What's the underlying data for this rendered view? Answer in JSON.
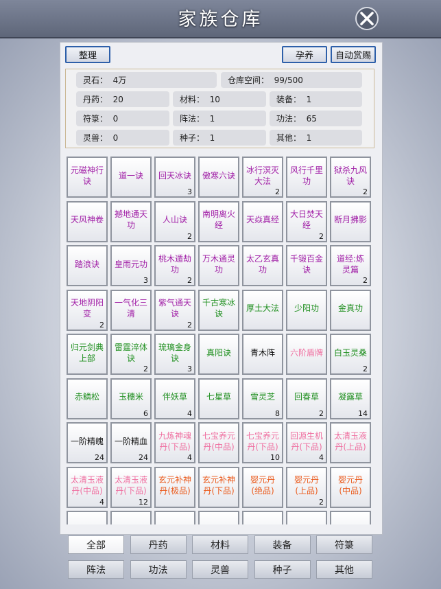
{
  "title": "家族仓库",
  "toolbar": {
    "sort": "整理",
    "breed": "孕养",
    "auto_reward": "自动赏赐"
  },
  "info": [
    {
      "label": "灵石：",
      "value": "4万"
    },
    {
      "label": "仓库空间：",
      "value": "99/500"
    },
    {
      "label": "丹药：",
      "value": "20"
    },
    {
      "label": "材料：",
      "value": "10"
    },
    {
      "label": "装备：",
      "value": "1"
    },
    {
      "label": "符箓：",
      "value": "0"
    },
    {
      "label": "阵法：",
      "value": "1"
    },
    {
      "label": "功法：",
      "value": "65"
    },
    {
      "label": "灵兽：",
      "value": "0"
    },
    {
      "label": "种子：",
      "value": "1"
    },
    {
      "label": "其他：",
      "value": "1"
    }
  ],
  "colors": {
    "purple": "#a01ea6",
    "green": "#1f8f1f",
    "black": "#111111",
    "pink": "#ef6fa0",
    "orange": "#ea5a1c"
  },
  "items": [
    {
      "name": "元磁神行诀",
      "count": "",
      "color": "purple"
    },
    {
      "name": "道一诀",
      "count": "",
      "color": "purple"
    },
    {
      "name": "回天冰诀",
      "count": "3",
      "color": "purple"
    },
    {
      "name": "傲寒六诀",
      "count": "",
      "color": "purple"
    },
    {
      "name": "冰行溟灭大法",
      "count": "2",
      "color": "purple"
    },
    {
      "name": "风行千里功",
      "count": "",
      "color": "purple"
    },
    {
      "name": "狱杀九风诀",
      "count": "2",
      "color": "purple"
    },
    {
      "name": "天风神卷",
      "count": "",
      "color": "purple"
    },
    {
      "name": "撼地通天功",
      "count": "",
      "color": "purple"
    },
    {
      "name": "人山诀",
      "count": "2",
      "color": "purple"
    },
    {
      "name": "南明离火经",
      "count": "",
      "color": "purple"
    },
    {
      "name": "天焱真经",
      "count": "",
      "color": "purple"
    },
    {
      "name": "大日焚天经",
      "count": "2",
      "color": "purple"
    },
    {
      "name": "断月拂影",
      "count": "",
      "color": "purple"
    },
    {
      "name": "踏浪诀",
      "count": "",
      "color": "purple"
    },
    {
      "name": "皇雨元功",
      "count": "3",
      "color": "purple"
    },
    {
      "name": "桃木遁劫功",
      "count": "2",
      "color": "purple"
    },
    {
      "name": "万木通灵功",
      "count": "",
      "color": "purple"
    },
    {
      "name": "太乙玄真功",
      "count": "",
      "color": "purple"
    },
    {
      "name": "千锻百金诀",
      "count": "",
      "color": "purple"
    },
    {
      "name": "道经:炼灵篇",
      "count": "2",
      "color": "purple"
    },
    {
      "name": "天地阴阳变",
      "count": "2",
      "color": "purple"
    },
    {
      "name": "一气化三清",
      "count": "",
      "color": "purple"
    },
    {
      "name": "紫气通天诀",
      "count": "2",
      "color": "purple"
    },
    {
      "name": "千古寒冰诀",
      "count": "",
      "color": "green"
    },
    {
      "name": "厚土大法",
      "count": "",
      "color": "green"
    },
    {
      "name": "少阳功",
      "count": "",
      "color": "green"
    },
    {
      "name": "金真功",
      "count": "",
      "color": "green"
    },
    {
      "name": "归元剑典上部",
      "count": "",
      "color": "green"
    },
    {
      "name": "雷霆淬体诀",
      "count": "2",
      "color": "green"
    },
    {
      "name": "琉璃金身诀",
      "count": "3",
      "color": "green"
    },
    {
      "name": "真阳诀",
      "count": "",
      "color": "green"
    },
    {
      "name": "青木阵",
      "count": "",
      "color": "black"
    },
    {
      "name": "六阶盾牌",
      "count": "",
      "color": "pink"
    },
    {
      "name": "白玉灵桑",
      "count": "2",
      "color": "green"
    },
    {
      "name": "赤鳞松",
      "count": "",
      "color": "green"
    },
    {
      "name": "玉穗米",
      "count": "6",
      "color": "green"
    },
    {
      "name": "伴妖草",
      "count": "4",
      "color": "green"
    },
    {
      "name": "七星草",
      "count": "",
      "color": "green"
    },
    {
      "name": "雪灵芝",
      "count": "8",
      "color": "green"
    },
    {
      "name": "回春草",
      "count": "2",
      "color": "green"
    },
    {
      "name": "凝露草",
      "count": "14",
      "color": "green"
    },
    {
      "name": "一阶精魄",
      "count": "24",
      "color": "black"
    },
    {
      "name": "一阶精血",
      "count": "24",
      "color": "black"
    },
    {
      "name": "九炼神魂丹(下品)",
      "count": "4",
      "color": "pink"
    },
    {
      "name": "七宝养元丹(中品)",
      "count": "",
      "color": "pink"
    },
    {
      "name": "七宝养元丹(下品)",
      "count": "10",
      "color": "pink"
    },
    {
      "name": "回源生机丹(下品)",
      "count": "4",
      "color": "pink"
    },
    {
      "name": "太清玉液丹(上品)",
      "count": "",
      "color": "pink"
    },
    {
      "name": "太清玉液丹(中品)",
      "count": "4",
      "color": "pink"
    },
    {
      "name": "太清玉液丹(下品)",
      "count": "12",
      "color": "pink"
    },
    {
      "name": "玄元补神丹(极品)",
      "count": "",
      "color": "orange"
    },
    {
      "name": "玄元补神丹(下品)",
      "count": "",
      "color": "orange"
    },
    {
      "name": "婴元丹(绝品)",
      "count": "",
      "color": "orange"
    },
    {
      "name": "婴元丹(上品)",
      "count": "2",
      "color": "orange"
    },
    {
      "name": "婴元丹(中品)",
      "count": "",
      "color": "orange"
    },
    {
      "name": "",
      "count": "",
      "color": "black"
    },
    {
      "name": "",
      "count": "",
      "color": "black"
    },
    {
      "name": "",
      "count": "",
      "color": "black"
    },
    {
      "name": "",
      "count": "",
      "color": "black"
    },
    {
      "name": "",
      "count": "",
      "color": "black"
    },
    {
      "name": "",
      "count": "",
      "color": "black"
    },
    {
      "name": "",
      "count": "",
      "color": "black"
    }
  ],
  "tabs": [
    "全部",
    "丹药",
    "材料",
    "装备",
    "符箓",
    "阵法",
    "功法",
    "灵兽",
    "种子",
    "其他"
  ],
  "active_tab": "全部"
}
